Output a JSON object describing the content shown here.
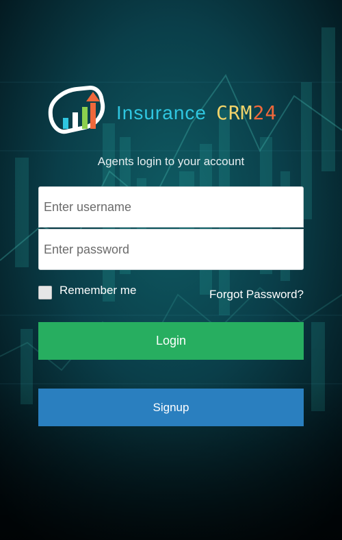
{
  "logo": {
    "part1": "Insurance",
    "part2": "CRM",
    "part3": "24",
    "icon": "handshake-growth-icon"
  },
  "tagline": "Agents login to your account",
  "form": {
    "username_placeholder": "Enter username",
    "password_placeholder": "Enter password",
    "remember_label": "Remember me",
    "forgot_label": "Forgot Password?"
  },
  "buttons": {
    "login": "Login",
    "signup": "Signup"
  },
  "colors": {
    "login": "#27ae60",
    "signup": "#2a7fbf",
    "logo_blue": "#2fc6e0",
    "logo_yellow": "#f1d36a",
    "logo_orange": "#f0683b"
  }
}
